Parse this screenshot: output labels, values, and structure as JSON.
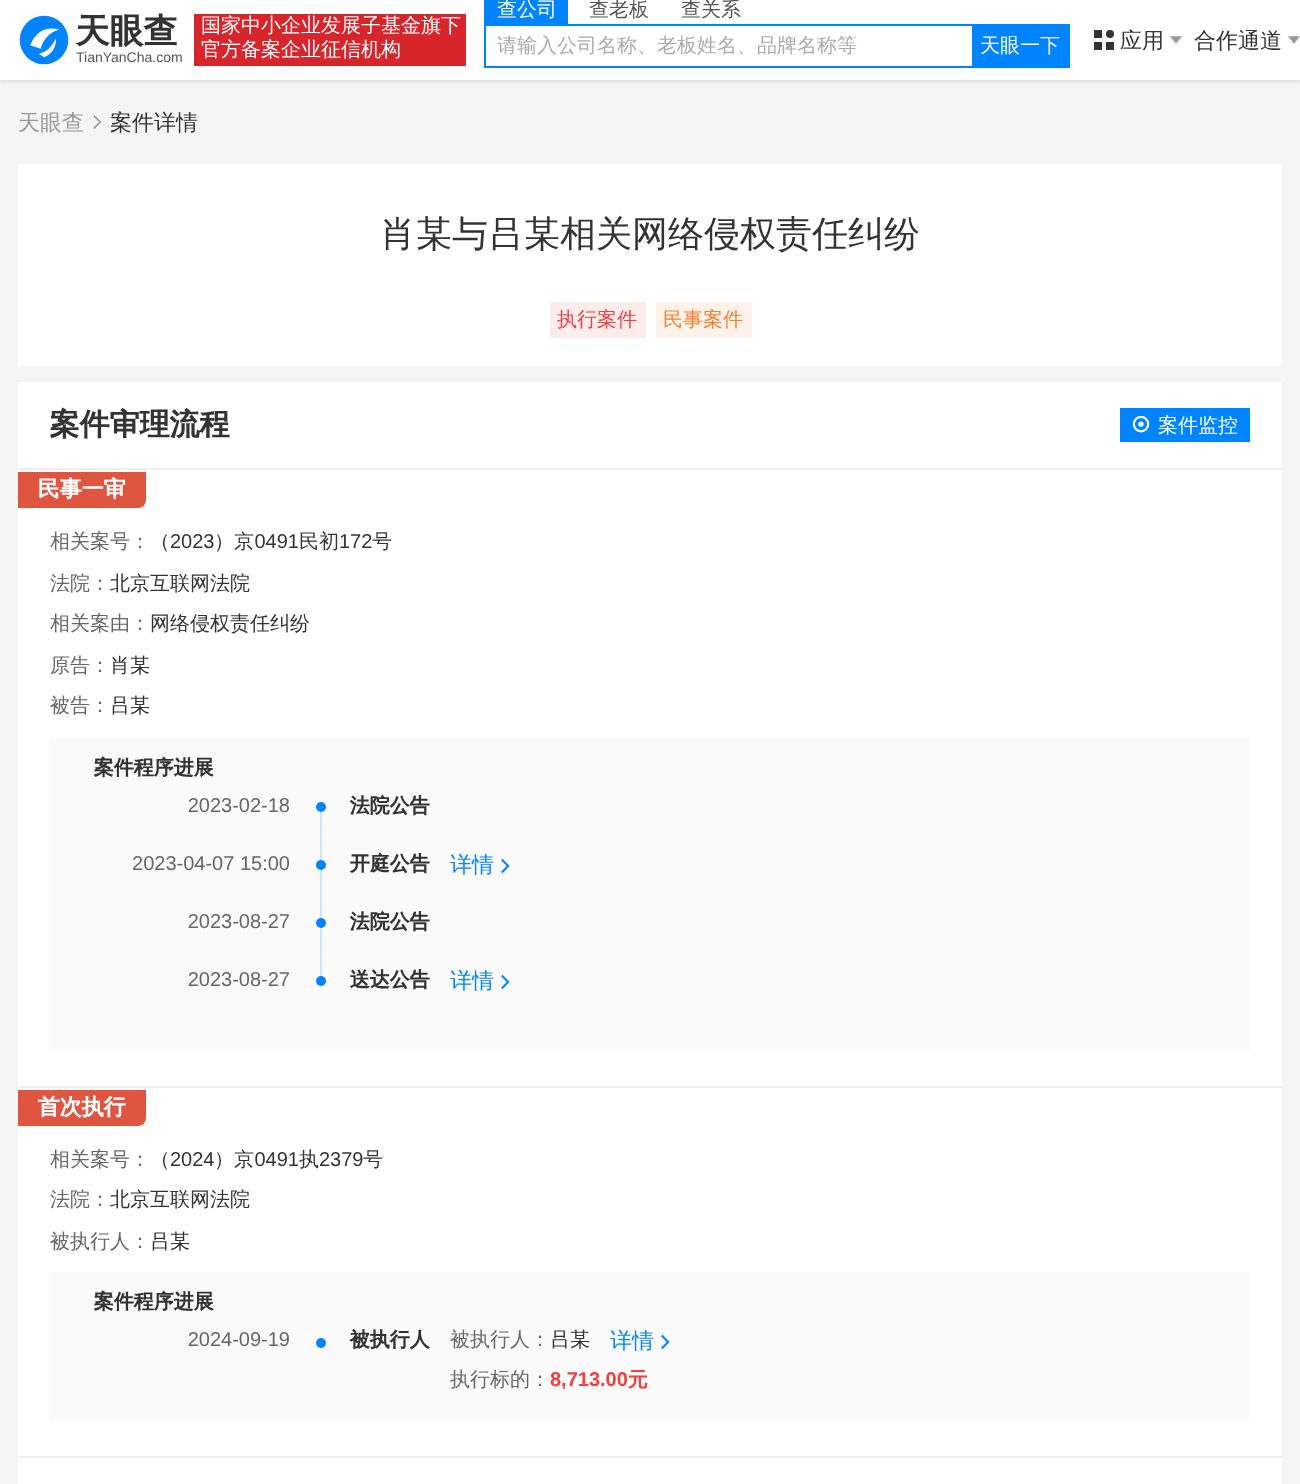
{
  "header": {
    "logo": {
      "name": "天眼查",
      "domain": "TianYanCha.com"
    },
    "banner": [
      "国家中小企业发展子基金旗下",
      "官方备案企业征信机构"
    ],
    "search_tabs": [
      {
        "label": "查公司",
        "selected": true
      },
      {
        "label": "查老板",
        "selected": false
      },
      {
        "label": "查关系",
        "selected": false
      }
    ],
    "search": {
      "placeholder": "请输入公司名称、老板姓名、品牌名称等",
      "button": "天眼一下"
    },
    "nav": [
      {
        "label": "应用"
      },
      {
        "label": "合作通道"
      }
    ]
  },
  "breadcrumb": [
    {
      "label": "天眼查",
      "selected": false
    },
    {
      "label": "案件详情",
      "selected": true
    }
  ],
  "case": {
    "title": "肖某与吕某相关网络侵权责任纠纷",
    "tags": [
      {
        "label": "执行案件",
        "color": "#f04040"
      },
      {
        "label": "民事案件",
        "color": "#f5812f"
      }
    ]
  },
  "process": {
    "title": "案件审理流程",
    "monitor_button": "案件监控",
    "stages": [
      {
        "name": "民事一审",
        "fields": [
          {
            "label": "相关案号：",
            "value": "（2023）京0491民初172号"
          },
          {
            "label": "法院：",
            "value": "北京互联网法院"
          },
          {
            "label": "相关案由：",
            "value": "网络侵权责任纠纷"
          },
          {
            "label": "原告：",
            "value": "肖某"
          },
          {
            "label": "被告：",
            "value": "吕某"
          }
        ],
        "progress_title": "案件程序进展",
        "events": [
          {
            "date": "2023-02-18",
            "title": "法院公告"
          },
          {
            "date": "2023-04-07 15:00",
            "title": "开庭公告",
            "link": "详情"
          },
          {
            "date": "2023-08-27",
            "title": "法院公告"
          },
          {
            "date": "2023-08-27",
            "title": "送达公告",
            "link": "详情"
          }
        ]
      },
      {
        "name": "首次执行",
        "fields": [
          {
            "label": "相关案号：",
            "value": "（2024）京0491执2379号"
          },
          {
            "label": "法院：",
            "value": "北京互联网法院"
          },
          {
            "label": "被执行人：",
            "value": "吕某"
          }
        ],
        "progress_title": "案件程序进展",
        "events": [
          {
            "date": "2024-09-19",
            "title": "被执行人",
            "link": "详情",
            "details": [
              {
                "label": "被执行人：",
                "value": "吕某",
                "kind": "plain"
              },
              {
                "label": "执行标的：",
                "value": "8,713.00元",
                "kind": "amount"
              }
            ]
          }
        ]
      }
    ]
  }
}
